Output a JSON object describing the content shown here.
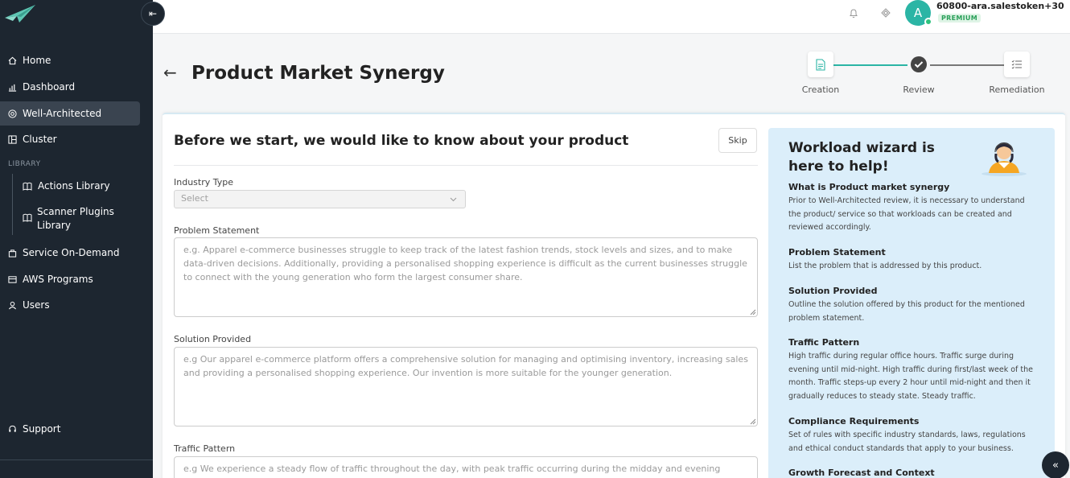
{
  "sidebar": {
    "nav": [
      {
        "label": "Home",
        "icon": "home-icon"
      },
      {
        "label": "Dashboard",
        "icon": "bar-chart-icon"
      },
      {
        "label": "Well-Architected",
        "icon": "target-icon"
      },
      {
        "label": "Cluster",
        "icon": "grid-icon"
      }
    ],
    "library_heading": "LIBRARY",
    "library_items": [
      {
        "label": "Actions Library",
        "icon": "book-icon"
      },
      {
        "label": "Scanner Plugins Library",
        "icon": "book-icon"
      }
    ],
    "nav2": [
      {
        "label": "Service On-Demand",
        "icon": "bag-icon"
      },
      {
        "label": "AWS Programs",
        "icon": "folder-icon"
      },
      {
        "label": "Users",
        "icon": "user-icon"
      }
    ],
    "support": "Support",
    "collapse_icon": "collapse-left-icon"
  },
  "topbar": {
    "avatar_letter": "A",
    "username": "60800-ara.salestoken+30",
    "badge": "PREMIUM"
  },
  "header": {
    "title": "Product Market Synergy",
    "steps": [
      {
        "label": "Creation",
        "icon": "document-icon",
        "state": "active"
      },
      {
        "label": "Review",
        "icon": "check-circle-icon",
        "state": "current"
      },
      {
        "label": "Remediation",
        "icon": "list-icon",
        "state": "pending"
      }
    ]
  },
  "form": {
    "title": "Before we start, we would like to know about your product",
    "skip": "Skip",
    "industry_label": "Industry Type",
    "industry_placeholder": "Select",
    "problem_label": "Problem Statement",
    "problem_placeholder": "e.g. Apparel e-commerce businesses struggle to keep track of the latest fashion trends, stock levels and sizes, and to make data-driven decisions. Additionally, providing a personalised shopping experience is difficult as the current businesses struggle to connect with the young generation who form the largest consumer share.",
    "solution_label": "Solution Provided",
    "solution_placeholder": "e.g Our apparel e-commerce platform offers a comprehensive solution for managing and optimising inventory, increasing sales and providing a personalised shopping experience. Our invention is more suitable for the younger generation.",
    "traffic_label": "Traffic Pattern",
    "traffic_placeholder": "e.g We experience a steady flow of traffic throughout the day, with peak traffic occurring during the midday and evening"
  },
  "help": {
    "title": "Workload wizard is here to help!",
    "sections": [
      {
        "heading": "What is Product market synergy",
        "text": "Prior to Well-Architected review, it is necessary to understand the product/ service so that workloads can be created and reviewed accordingly."
      },
      {
        "heading": "Problem Statement",
        "text": "List the problem that is addressed by this product."
      },
      {
        "heading": "Solution Provided",
        "text": "Outline the solution offered by this product for the mentioned problem statement."
      },
      {
        "heading": "Traffic Pattern",
        "text": "High traffic during regular office hours. Traffic surge during evening until mid-night. High traffic during first/last week of the month. Traffic steps-up every 2 hour until mid-night and then it gradually reduces to steady state. Steady traffic."
      },
      {
        "heading": "Compliance Requirements",
        "text": "Set of rules with specific industry standards, laws, regulations and ethical conduct standards that apply to your business."
      },
      {
        "heading": "Growth Forecast and Context",
        "text": ""
      }
    ]
  },
  "colors": {
    "sidebar_bg": "#1d2630",
    "accent": "#2bb5a5",
    "help_bg": "#dbeefa",
    "premium": "#2ba05a"
  }
}
